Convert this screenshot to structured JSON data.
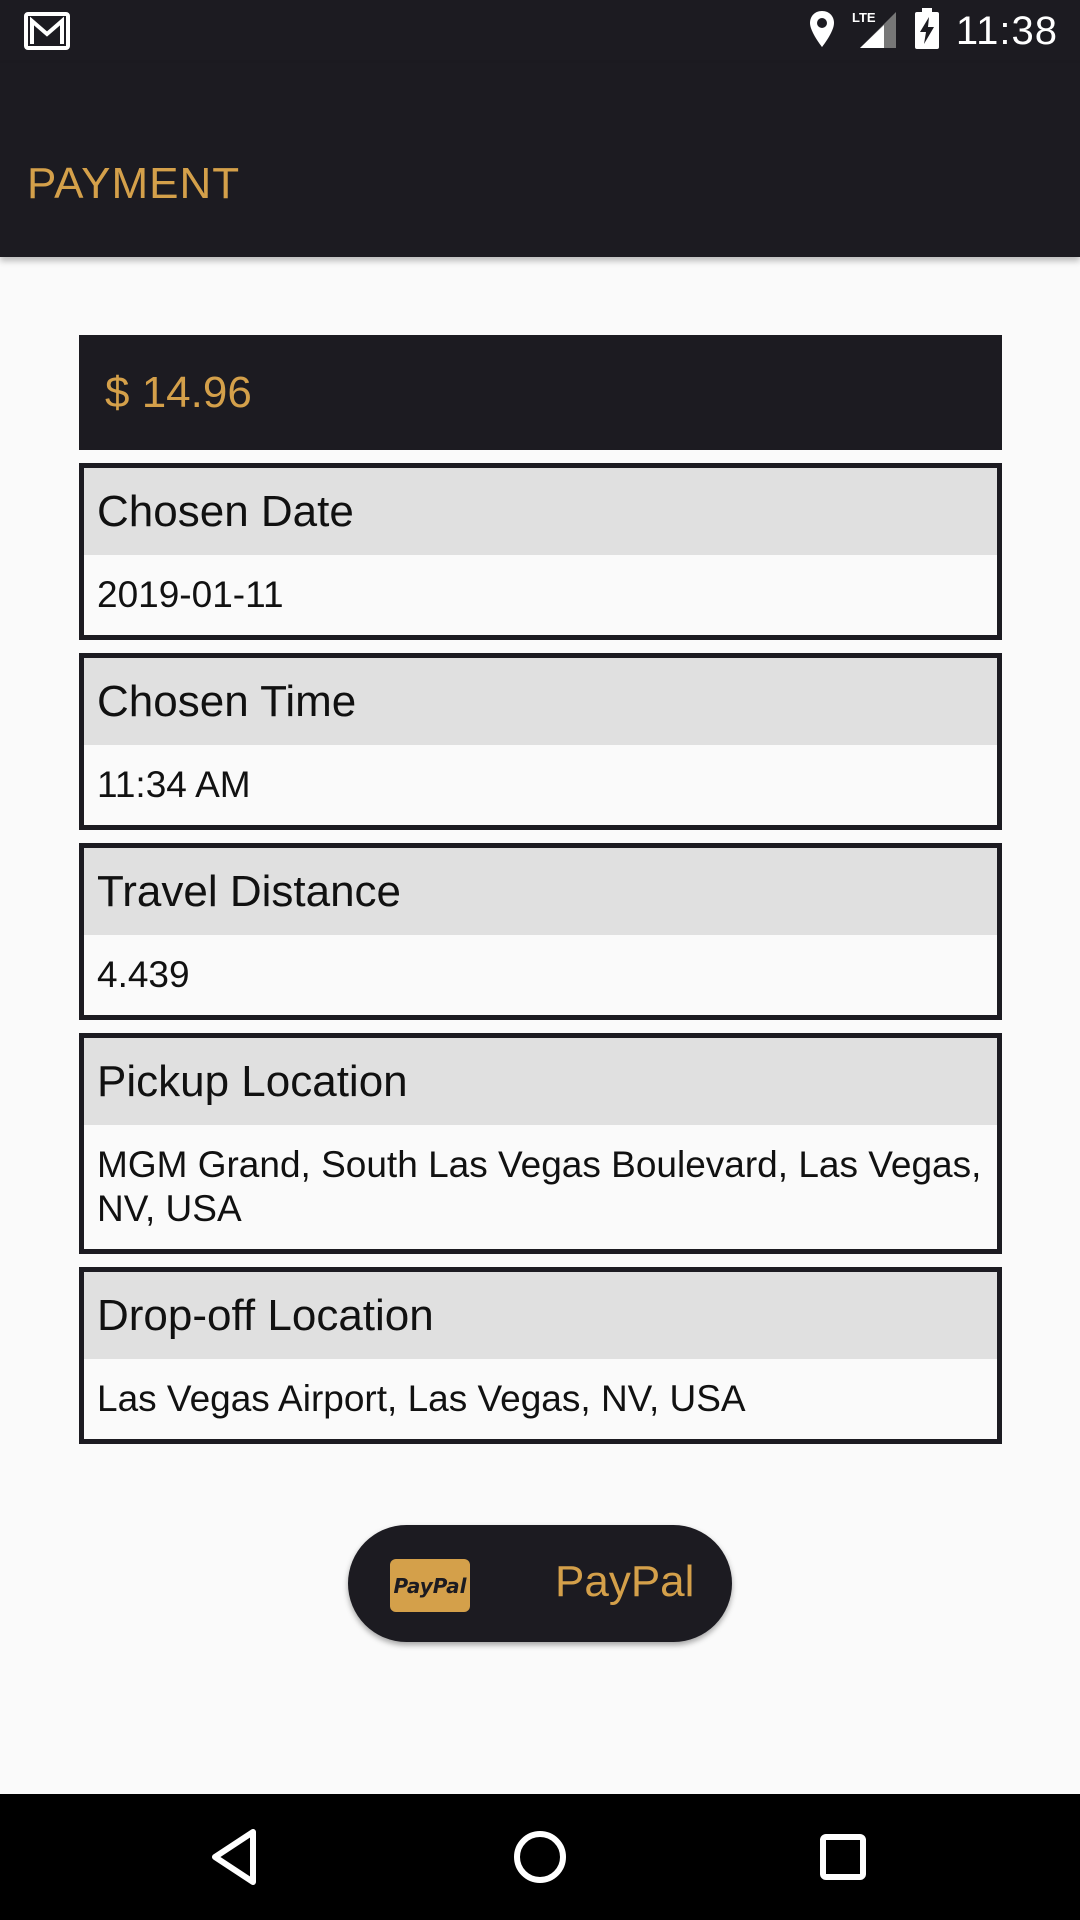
{
  "status_bar": {
    "time": "11:38",
    "icons": [
      "gmail-icon",
      "location-icon",
      "lte-signal-icon",
      "battery-charging-icon"
    ],
    "network_label": "LTE"
  },
  "app_bar": {
    "title": "PAYMENT"
  },
  "price": {
    "text": "$ 14.96"
  },
  "cards": [
    {
      "title": "Chosen Date",
      "value": "2019-01-11"
    },
    {
      "title": "Chosen Time",
      "value": "11:34 AM"
    },
    {
      "title": "Travel Distance",
      "value": "4.439"
    },
    {
      "title": "Pickup Location",
      "value": "MGM Grand, South Las Vegas Boulevard, Las Vegas, NV, USA"
    },
    {
      "title": "Drop-off Location",
      "value": "Las Vegas Airport, Las Vegas, NV, USA"
    }
  ],
  "paypal_button": {
    "logo_text": "PayPal",
    "label": "PayPal"
  },
  "nav_bar": {
    "buttons": [
      "back-icon",
      "home-icon",
      "recents-icon"
    ]
  },
  "colors": {
    "primary_dark": "#1c1b21",
    "accent_gold": "#d4a04a",
    "card_header_bg": "#e0e0e0",
    "background": "#fafafa"
  }
}
